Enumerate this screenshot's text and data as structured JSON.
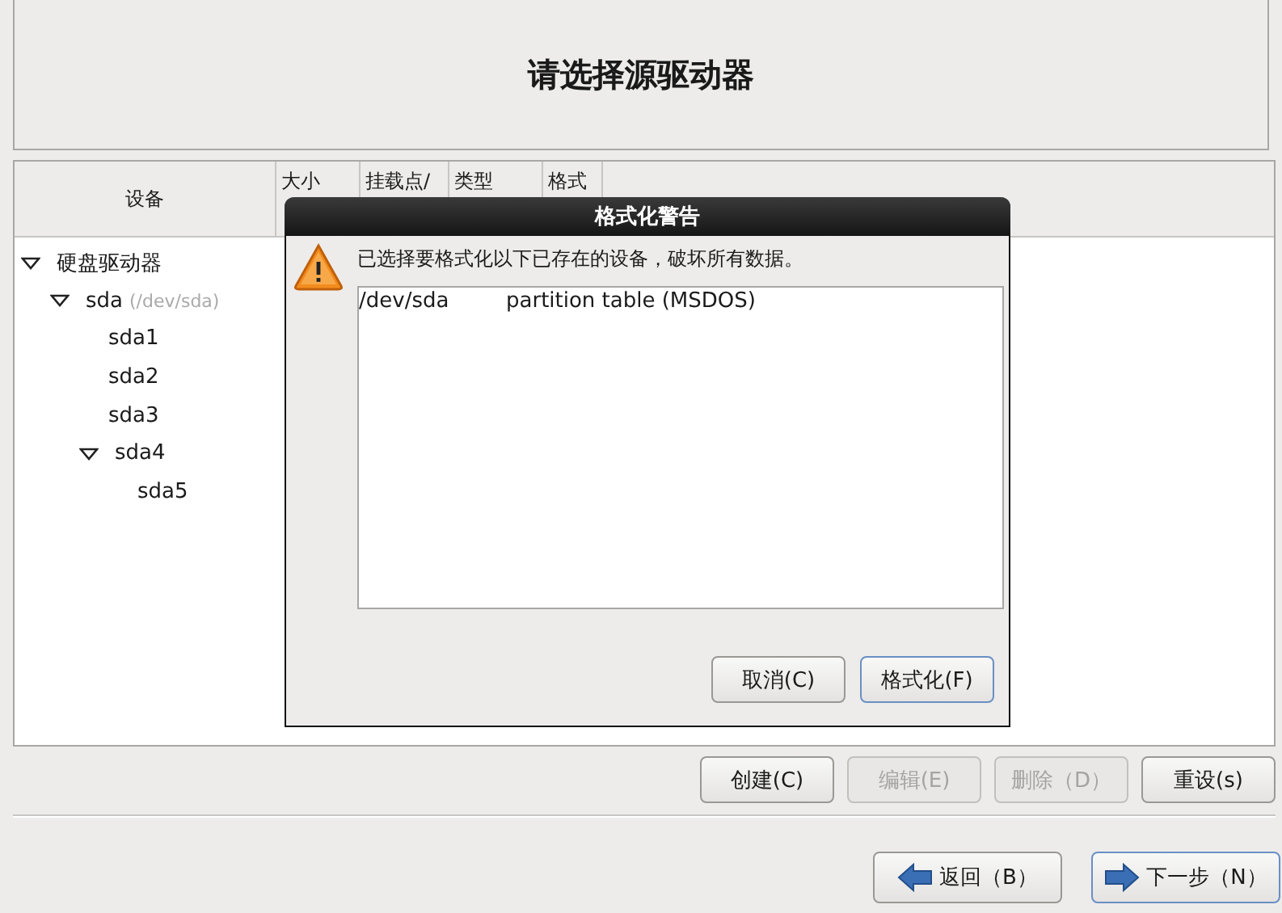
{
  "header": {
    "title": "请选择源驱动器"
  },
  "table": {
    "columns": [
      "设备",
      "大小",
      "挂载点/",
      "类型",
      "格式"
    ],
    "tree": [
      {
        "label": "硬盘驱动器",
        "expanded": true,
        "children": [
          {
            "label": "sda",
            "note": "(/dev/sda)",
            "expanded": true,
            "children": [
              {
                "label": "sda1"
              },
              {
                "label": "sda2"
              },
              {
                "label": "sda3"
              },
              {
                "label": "sda4",
                "expanded": true,
                "children": [
                  {
                    "label": "sda5"
                  }
                ]
              }
            ]
          }
        ]
      }
    ]
  },
  "actions": [
    {
      "label": "创建(C)",
      "disabled": false
    },
    {
      "label": "编辑(E)",
      "disabled": true
    },
    {
      "label": "删除（D）",
      "disabled": true
    },
    {
      "label": "重设(s)",
      "disabled": false
    }
  ],
  "nav": [
    {
      "label": "返回（B）",
      "kind": "back"
    },
    {
      "label": "下一步（N）",
      "kind": "next"
    }
  ],
  "dialog": {
    "title": "格式化警告",
    "message": "已选择要格式化以下已存在的设备，破坏所有数据。",
    "devices": [
      {
        "device": "/dev/sda",
        "description": "partition table (MSDOS)"
      }
    ],
    "buttons": [
      {
        "label": "取消(C)",
        "focused": false
      },
      {
        "label": "格式化(F)",
        "focused": true
      }
    ]
  }
}
